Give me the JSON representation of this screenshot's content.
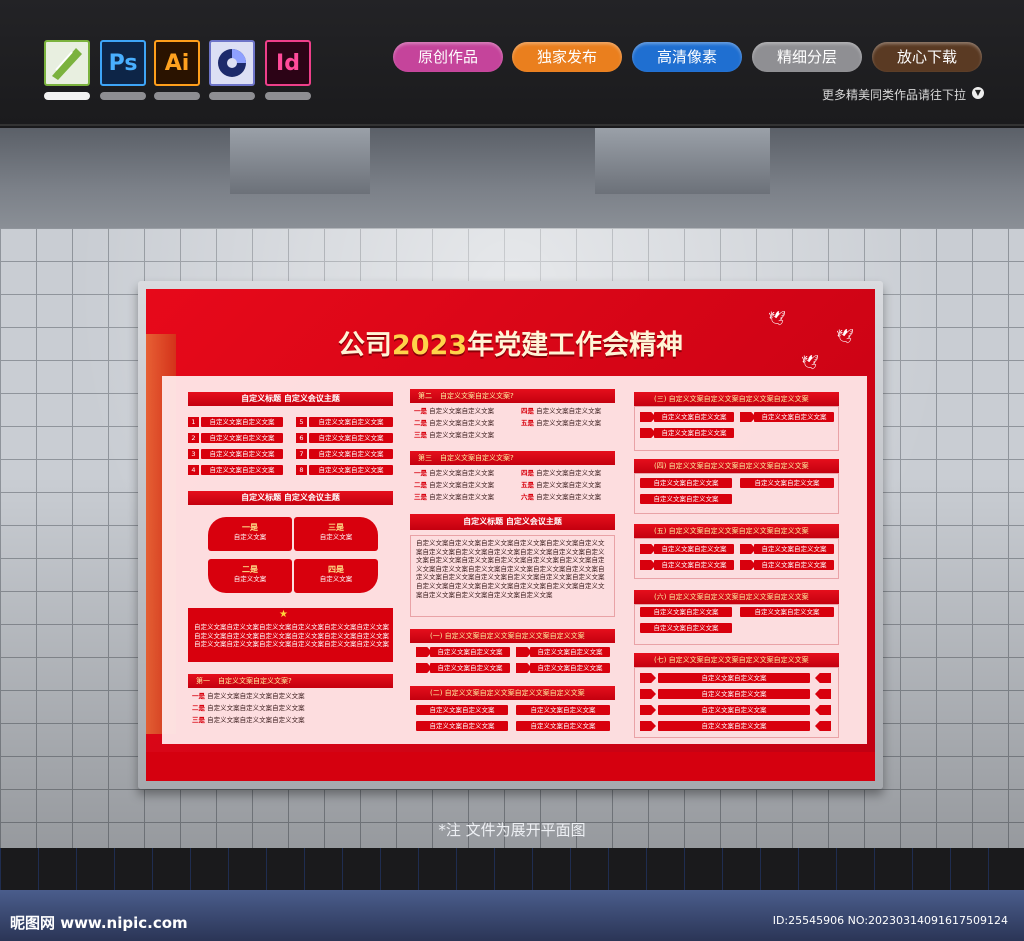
{
  "software_icons": [
    {
      "name": "coreldraw-icon",
      "label": ""
    },
    {
      "name": "photoshop-icon",
      "label": "Ps"
    },
    {
      "name": "illustrator-icon",
      "label": "Ai"
    },
    {
      "name": "cinema4d-icon",
      "label": ""
    },
    {
      "name": "indesign-icon",
      "label": "Id"
    }
  ],
  "feature_tags": [
    {
      "label": "原创作品",
      "color": "#c5449b"
    },
    {
      "label": "独家发布",
      "color": "#ea7f1e"
    },
    {
      "label": "高清像素",
      "color": "#1f6fd1"
    },
    {
      "label": "精细分层",
      "color": "#8f8f93"
    },
    {
      "label": "放心下载",
      "color": "#5a3a23"
    }
  ],
  "more_text": "更多精美同类作品请往下拉",
  "board": {
    "title_pre": "公司",
    "title_year": "2023",
    "title_post": "年党建工作会精神",
    "left": {
      "section1_title": "自定义标题 自定义会议主题",
      "nums": [
        "1",
        "2",
        "3",
        "4",
        "5",
        "6",
        "7",
        "8"
      ],
      "item": "自定义文案自定义文案",
      "section2_title": "自定义标题 自定义会议主题",
      "petals": [
        {
          "head": "一是",
          "text": "自定义文案"
        },
        {
          "head": "三是",
          "text": "自定义文案"
        },
        {
          "head": "二是",
          "text": "自定义文案"
        },
        {
          "head": "四是",
          "text": "自定义文案"
        }
      ],
      "star_text": "自定义文案自定义文案自定义文案自定义文案自定义文案自定义文案自定义文案自定义文案自定义文案自定义文案自定义文案自定义文案自定义文案自定义文案自定义文案自定义文案自定义文案自定义文案",
      "q_label": "第一",
      "q_text": "自定义文案自定义文案?",
      "lines": [
        {
          "k": "一是",
          "v": "自定义文案自定义文案自定义文案"
        },
        {
          "k": "二是",
          "v": "自定义文案自定义文案自定义文案"
        },
        {
          "k": "三是",
          "v": "自定义文案自定义文案自定义文案"
        }
      ]
    },
    "mid": {
      "q2_label": "第二",
      "q2_text": "自定义文案自定义文案?",
      "q2_lines": [
        {
          "k": "一是",
          "v": "自定义文案自定义文案"
        },
        {
          "k": "二是",
          "v": "自定义文案自定义文案"
        },
        {
          "k": "三是",
          "v": "自定义文案自定义文案"
        },
        {
          "k": "四是",
          "v": "自定义文案自定义文案"
        },
        {
          "k": "五是",
          "v": "自定义文案自定义文案"
        }
      ],
      "q3_label": "第三",
      "q3_text": "自定义文案自定义文案?",
      "q3_lines": [
        {
          "k": "一是",
          "v": "自定义文案自定义文案"
        },
        {
          "k": "二是",
          "v": "自定义文案自定义文案"
        },
        {
          "k": "三是",
          "v": "自定义文案自定义文案"
        },
        {
          "k": "四是",
          "v": "自定义文案自定义文案"
        },
        {
          "k": "五是",
          "v": "自定义文案自定义文案"
        },
        {
          "k": "六是",
          "v": "自定义文案自定义文案"
        }
      ],
      "section_title": "自定义标题 自定义会议主题",
      "paragraph": "自定义文案自定义文案自定义文案自定义文案自定义文案自定义文案自定义文案自定义文案自定义文案自定义文案自定义文案自定义文案自定义文案自定义文案自定义文案自定义文案自定义文案自定义文案自定义文案自定义文案自定义文案自定义文案自定义文案自定义文案自定义文案自定义文案自定义文案自定义文案自定义文案自定义文案自定义文案自定义文案自定义文案自定义文案自定义文案自定义文案自定义文案自定义文案自定义文案",
      "sub1": "(一) 自定义文案自定义文案自定义文案自定义文案",
      "sub2": "(二) 自定义文案自定义文案自定义文案自定义文案",
      "pill_text": "自定义文案自定义文案"
    },
    "right": {
      "sub3": "(三) 自定义文案自定义文案自定义文案自定义文案",
      "sub4": "(四) 自定义文案自定义文案自定义文案自定义文案",
      "sub5": "(五) 自定义文案自定义文案自定义文案自定义文案",
      "sub6": "(六) 自定义文案自定义文案自定义文案自定义文案",
      "sub7": "(七) 自定义文案自定义文案自定义文案自定义文案",
      "pill_text": "自定义文案自定义文案"
    }
  },
  "note": "*注  文件为展开平面图",
  "footer_left": "昵图网 www.nipic.com",
  "footer_right": "ID:25545906 NO:20230314091617509124"
}
